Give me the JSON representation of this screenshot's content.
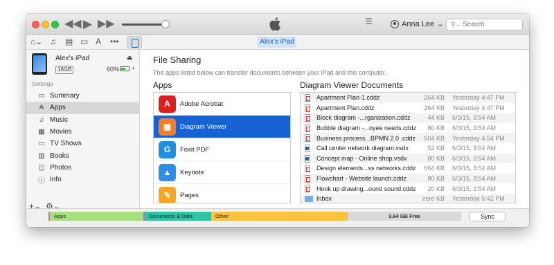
{
  "toolbar": {
    "transport": {
      "rewind": "◀◀",
      "play": "▶",
      "forward": "▶▶"
    },
    "account_name": "Anna Lee",
    "account_caret": "⌄",
    "search_placeholder": "Search"
  },
  "media_bar": {
    "icons": [
      "home-device-icon",
      "music-note-icon",
      "film-icon",
      "tv-icon",
      "app-store-icon",
      "more-icon",
      "ipad-icon"
    ],
    "device_tab": "Alex's iPad"
  },
  "device": {
    "name": "Alex's iPad",
    "capacity": "16GB",
    "battery_percent_label": "60%",
    "battery_level": 0.6,
    "eject_glyph": "⏏",
    "charge_glyph": "+"
  },
  "sidebar": {
    "section_label": "Settings",
    "items": [
      {
        "label": "Summary",
        "icon": "summary-icon",
        "glyph": "▭",
        "active": false
      },
      {
        "label": "Apps",
        "icon": "apps-icon",
        "glyph": "A",
        "active": true
      },
      {
        "label": "Music",
        "icon": "music-icon",
        "glyph": "♫",
        "active": false
      },
      {
        "label": "Movies",
        "icon": "movies-icon",
        "glyph": "▦",
        "active": false
      },
      {
        "label": "TV Shows",
        "icon": "tv-shows-icon",
        "glyph": "▭",
        "active": false
      },
      {
        "label": "Books",
        "icon": "books-icon",
        "glyph": "▥",
        "active": false
      },
      {
        "label": "Photos",
        "icon": "photos-icon",
        "glyph": "◫",
        "active": false
      },
      {
        "label": "Info",
        "icon": "info-icon",
        "glyph": "ⓘ",
        "active": false
      }
    ],
    "footer": {
      "add": "+⌄",
      "gear": "⚙⌄"
    }
  },
  "file_sharing": {
    "title": "File Sharing",
    "description": "The apps listed below can transfer documents between your iPad and this computer.",
    "apps_heading": "Apps",
    "docs_heading": "Diagram Viewer Documents",
    "apps": [
      {
        "name": "Adobe Acrobat",
        "color": "#d8201e",
        "glyph": "A",
        "selected": false
      },
      {
        "name": "Diagram Viewer",
        "color": "#f47e28",
        "glyph": "▣",
        "selected": true
      },
      {
        "name": "Foxit PDF",
        "color": "#1f8fe0",
        "glyph": "G",
        "selected": false
      },
      {
        "name": "Keynote",
        "color": "#2b8fe6",
        "glyph": "▲",
        "selected": false
      },
      {
        "name": "Pages",
        "color": "#f5a623",
        "glyph": "✎",
        "selected": false
      }
    ],
    "documents": [
      {
        "name": "Apartment Plan-1.cddz",
        "size": "264 KB",
        "date": "Yesterday 4:47 PM",
        "type": "cddz"
      },
      {
        "name": "Apartment Plan.cddz",
        "size": "264 KB",
        "date": "Yesterday 4:47 PM",
        "type": "cddz"
      },
      {
        "name": "Block diagram -...rganization.cddz",
        "size": "44 KB",
        "date": "6/3/15, 3:54 AM",
        "type": "cddz"
      },
      {
        "name": "Bubble diagram -...oyee needs.cddz",
        "size": "80 KB",
        "date": "6/3/15, 3:54 AM",
        "type": "cddz"
      },
      {
        "name": "Business process...BPMN 2.0 .cddz",
        "size": "504 KB",
        "date": "Yesterday 4:54 PM",
        "type": "cddz"
      },
      {
        "name": "Call center network diagram.vsdx",
        "size": "52 KB",
        "date": "6/3/15, 3:54 AM",
        "type": "vsdx"
      },
      {
        "name": "Concept map - Online shop.vsdx",
        "size": "80 KB",
        "date": "6/3/15, 3:54 AM",
        "type": "vsdx"
      },
      {
        "name": "Design elements...ss networks.cddz",
        "size": "664 KB",
        "date": "6/3/15, 3:54 AM",
        "type": "cddz"
      },
      {
        "name": "Flowchart - Website launch.cddz",
        "size": "80 KB",
        "date": "6/3/15, 3:54 AM",
        "type": "cddz"
      },
      {
        "name": "Hook up drawing...ound sound.cddz",
        "size": "20 KB",
        "date": "6/3/15, 3:54 AM",
        "type": "cddz"
      },
      {
        "name": "Inbox",
        "size": "zero KB",
        "date": "Yesterday 5:42 PM",
        "type": "folder"
      }
    ]
  },
  "storage": {
    "apps_label": "Apps",
    "docs_label": "Documents & Data",
    "other_label": "Other",
    "free_label": "3.64 GB Free",
    "sync_label": "Sync"
  }
}
